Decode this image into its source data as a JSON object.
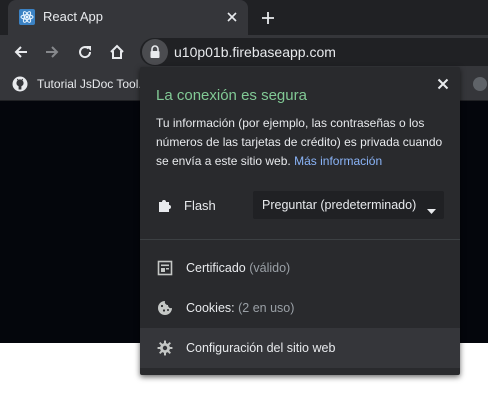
{
  "browser": {
    "tab_title": "React App",
    "url": "u10p01b.firebaseapp.com",
    "bookmark_label": "Tutorial JsDoc Tool..."
  },
  "icons": {
    "tab_favicon": "react-icon",
    "tab_close": "close-icon",
    "new_tab": "plus-icon",
    "back": "arrow-left-icon",
    "forward": "arrow-right-icon",
    "reload": "reload-icon",
    "home": "home-icon",
    "site_info": "lock-icon",
    "bookmark_favicon": "github-icon",
    "flash": "puzzle-icon",
    "certificate": "certificate-icon",
    "cookies": "cookie-icon",
    "settings": "gear-icon"
  },
  "popup": {
    "title": "La conexión es segura",
    "description": "Tu información (por ejemplo, las contraseñas o los números de las tarjetas de crédito) es privada cuando se envía a este sitio web.",
    "link": "Más información",
    "permission": {
      "label": "Flash",
      "value": "Preguntar (predeterminado)"
    },
    "items": [
      {
        "label": "Certificado",
        "sub": "(válido)"
      },
      {
        "label": "Cookies:",
        "sub": "(2 en uso)"
      },
      {
        "label": "Configuración del sitio web",
        "sub": ""
      }
    ]
  },
  "colors": {
    "secure_green": "#81c995",
    "link_blue": "#8ab4f8",
    "popup_bg": "#292a2d",
    "toolbar_bg": "#35363a",
    "tabstrip_bg": "#202124"
  }
}
